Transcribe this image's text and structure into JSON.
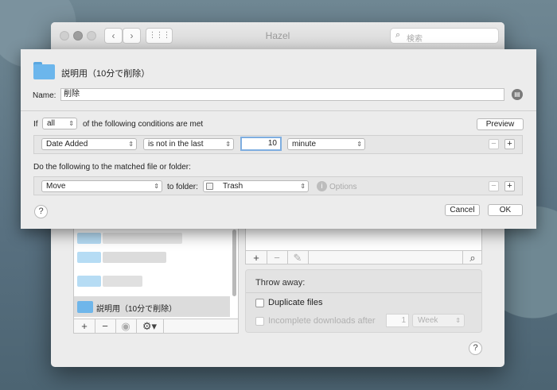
{
  "window": {
    "title": "Hazel",
    "search_placeholder": "検索"
  },
  "folders": {
    "selected_label": "説明用（10分で削除）"
  },
  "rules_toolbar": {
    "add": "+",
    "remove": "—"
  },
  "throw_away": {
    "header": "Throw away:",
    "duplicate_files": "Duplicate files",
    "incomplete_downloads": "Incomplete downloads after",
    "incomplete_value": "1",
    "incomplete_unit": "Week"
  },
  "sheet": {
    "title": "説明用（10分で削除）",
    "name_label": "Name:",
    "name_value": "削除",
    "if_label": "If",
    "match_select": "all",
    "conditions_label": "of the following conditions are met",
    "preview_button": "Preview",
    "condition": {
      "attribute": "Date Added",
      "operator": "is not in the last",
      "value": "10",
      "unit": "minute"
    },
    "do_label": "Do the following to the matched file or folder:",
    "action": {
      "verb": "Move",
      "to_folder_label": "to folder:",
      "target": "Trash",
      "options": "Options"
    },
    "cancel_button": "Cancel",
    "ok_button": "OK"
  },
  "colors": {
    "folder": "#6cb6ec",
    "selection": "#dcdcdc",
    "focus_ring": "#7faee0"
  }
}
